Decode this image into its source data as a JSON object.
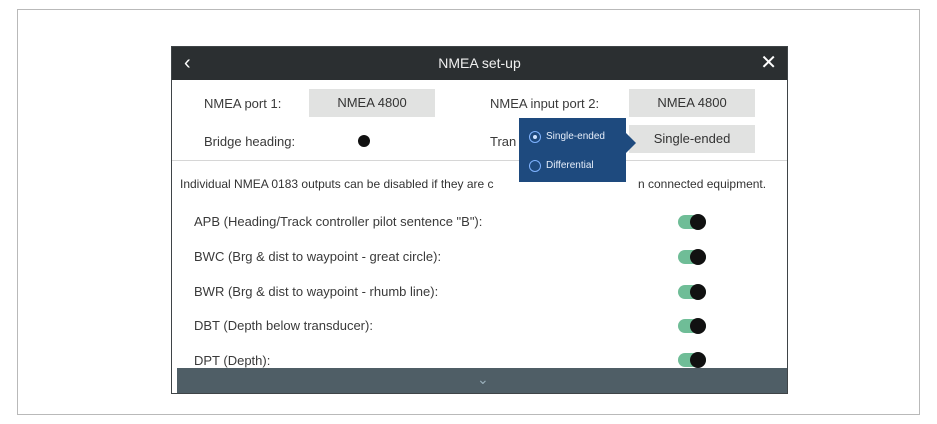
{
  "dialog": {
    "title": "NMEA set-up",
    "back_icon": "chevron-left-icon",
    "close_icon": "close-icon"
  },
  "settings": {
    "port1_label": "NMEA port 1:",
    "port1_value": "NMEA 4800",
    "input_port2_label": "NMEA input port 2:",
    "input_port2_value": "NMEA 4800",
    "bridge_heading_label": "Bridge heading:",
    "bridge_heading_on": false,
    "transmission_label_visible": "Tran",
    "transmission_value": "Single-ended"
  },
  "popup": {
    "options": [
      {
        "label": "Single-ended",
        "selected": true
      },
      {
        "label": "Differential",
        "selected": false
      }
    ]
  },
  "info_text": "Individual NMEA 0183 outputs can be disabled if they are c",
  "info_text_tail": "n connected equipment.",
  "outputs": [
    {
      "label": "APB (Heading/Track controller pilot sentence \"B\"):",
      "enabled": true
    },
    {
      "label": "BWC (Brg & dist to waypoint - great circle):",
      "enabled": true
    },
    {
      "label": "BWR (Brg & dist to waypoint - rhumb line):",
      "enabled": true
    },
    {
      "label": "DBT (Depth below transducer):",
      "enabled": true
    },
    {
      "label": "DPT (Depth):",
      "enabled": true
    }
  ],
  "colors": {
    "titlebar": "#2b2f31",
    "popup": "#1e4a7e",
    "toggle_on": "#6fbd97",
    "bottombar": "#4f5e66"
  }
}
